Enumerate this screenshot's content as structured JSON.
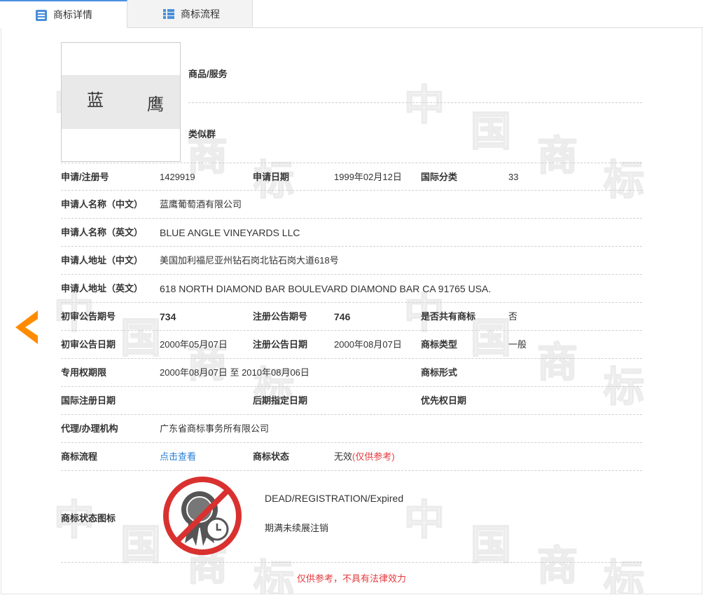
{
  "tabs": [
    {
      "label": "商标详情",
      "icon": "document-list-icon",
      "active": true
    },
    {
      "label": "商标流程",
      "icon": "grid-list-icon",
      "active": false
    }
  ],
  "mark": {
    "chars": [
      "蓝",
      "鹰"
    ],
    "watermark_chars": [
      "中",
      "国",
      "商",
      "标"
    ]
  },
  "side": {
    "goods_label": "商品/服务",
    "similar_label": "类似群"
  },
  "fields": {
    "reg_no_label": "申请/注册号",
    "reg_no": "1429919",
    "app_date_label": "申请日期",
    "app_date": "1999年02月12日",
    "intl_class_label": "国际分类",
    "intl_class": "33",
    "applicant_cn_label": "申请人名称（中文）",
    "applicant_cn": "蓝鹰葡萄酒有限公司",
    "applicant_en_label": "申请人名称（英文）",
    "applicant_en": "BLUE ANGLE VINEYARDS LLC",
    "address_cn_label": "申请人地址（中文）",
    "address_cn": "美国加利福尼亚州钻石岗北钻石岗大道618号",
    "address_en_label": "申请人地址（英文）",
    "address_en": "618 NORTH DIAMOND BAR BOULEVARD DIAMOND BAR CA 91765 USA.",
    "prelim_no_label": "初审公告期号",
    "prelim_no": "734",
    "reg_pub_no_label": "注册公告期号",
    "reg_pub_no": "746",
    "shared_label": "是否共有商标",
    "shared": "否",
    "prelim_date_label": "初审公告日期",
    "prelim_date": "2000年05月07日",
    "reg_pub_date_label": "注册公告日期",
    "reg_pub_date": "2000年08月07日",
    "mark_type_label": "商标类型",
    "mark_type": "一般",
    "exclusive_label": "专用权期限",
    "exclusive": "2000年08月07日 至 2010年08月06日",
    "mark_form_label": "商标形式",
    "mark_form": "",
    "intl_reg_date_label": "国际注册日期",
    "intl_reg_date": "",
    "later_date_label": "后期指定日期",
    "later_date": "",
    "priority_label": "优先权日期",
    "priority": "",
    "agent_label": "代理/办理机构",
    "agent": "广东省商标事务所有限公司",
    "flow_label": "商标流程",
    "flow_link": "点击查看",
    "status_label": "商标状态",
    "status_value": "无效",
    "status_note": "(仅供参考)",
    "status_icon_label": "商标状态图标",
    "status_en": "DEAD/REGISTRATION/Expired",
    "status_cn": "期满未续展注销"
  },
  "footer": {
    "note": "仅供参考，不具有法律效力"
  },
  "colors": {
    "accent": "#4a90e2",
    "link": "#2a7fd4",
    "red": "#e4393c",
    "arrow": "#ff8c00",
    "status_ring": "#d9312f"
  }
}
